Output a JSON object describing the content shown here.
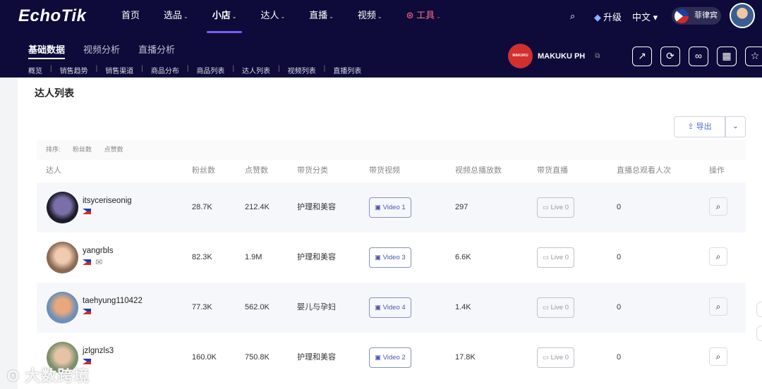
{
  "app": {
    "logo": "EchoTik"
  },
  "nav": {
    "items": [
      {
        "label": "首页",
        "caret": false
      },
      {
        "label": "选品",
        "caret": true
      },
      {
        "label": "小店",
        "caret": true,
        "active": true
      },
      {
        "label": "达人",
        "caret": true
      },
      {
        "label": "直播",
        "caret": true
      },
      {
        "label": "视频",
        "caret": true
      },
      {
        "label": "工具",
        "caret": true
      }
    ],
    "upgrade": "升级",
    "language": "中文",
    "region": "菲律宾"
  },
  "subnav": {
    "tabs": [
      "基础数据",
      "视频分析",
      "直播分析"
    ],
    "links": [
      "概览",
      "销售趋势",
      "销售渠道",
      "商品分布",
      "商品列表",
      "达人列表",
      "视频列表",
      "直播列表"
    ]
  },
  "shop": {
    "logo_text": "MAKUKU",
    "name": "MAKUKU PH"
  },
  "panel": {
    "title": "达人列表",
    "export_label": "导出",
    "sort_label": "排序:",
    "sort_options": [
      "粉丝数",
      "点赞数"
    ],
    "columns": [
      "达人",
      "粉丝数",
      "点赞数",
      "带货分类",
      "带货视频",
      "视频总播放数",
      "带货直播",
      "直播总观看人次",
      "操作"
    ]
  },
  "rows": [
    {
      "name": "itsyceriseonig",
      "followers": "28.7K",
      "likes": "212.4K",
      "category": "护理和美容",
      "video": "Video 1",
      "plays": "297",
      "live": "Live 0",
      "viewers": "0",
      "mail": false
    },
    {
      "name": "yangrbls",
      "followers": "82.3K",
      "likes": "1.9M",
      "category": "护理和美容",
      "video": "Video 3",
      "plays": "6.6K",
      "live": "Live 0",
      "viewers": "0",
      "mail": true
    },
    {
      "name": "taehyung110422",
      "followers": "77.3K",
      "likes": "562.0K",
      "category": "婴儿与孕妇",
      "video": "Video 4",
      "plays": "1.4K",
      "live": "Live 0",
      "viewers": "0",
      "mail": false
    },
    {
      "name": "jzlgnzls3",
      "followers": "160.0K",
      "likes": "750.8K",
      "category": "护理和美容",
      "video": "Video 2",
      "plays": "17.8K",
      "live": "Live 0",
      "viewers": "0",
      "mail": false
    }
  ],
  "watermark": "大数跨境"
}
